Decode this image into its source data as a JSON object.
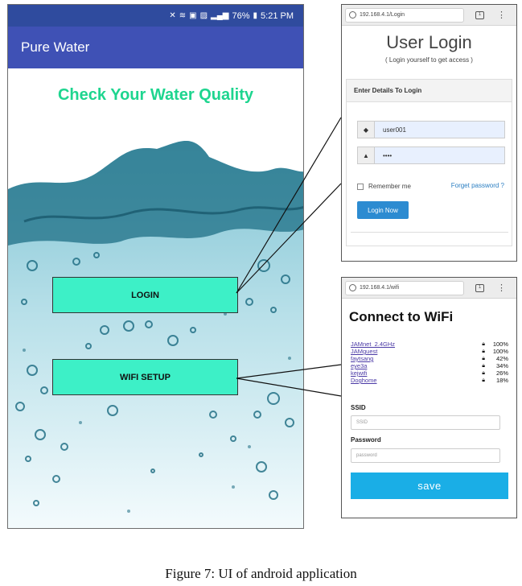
{
  "phone": {
    "status": {
      "battery": "76%",
      "time": "5:21 PM"
    },
    "app_title": "Pure Water",
    "headline": "Check Your Water Quality",
    "login_button": "LOGIN",
    "wifi_button": "WIFI SETUP",
    "colors": {
      "appbar": "#3f51b5",
      "headline": "#1ed58f",
      "button": "#3df0c7"
    }
  },
  "login_panel": {
    "url": "192.168.4.1/Login",
    "title": "User Login",
    "subtitle": "( Login yourself to get access )",
    "card_header": "Enter Details To Login",
    "username_value": "user001",
    "password_value": "••••",
    "remember_label": "Remember me",
    "forgot_link": "Forget password ?",
    "submit_label": "Login Now"
  },
  "wifi_panel": {
    "url": "192.168.4.1/wifi",
    "title": "Connect to WiFi",
    "networks": [
      {
        "name": "JAMnet_2.4GHz",
        "signal": "100%"
      },
      {
        "name": "JAMguest",
        "signal": "100%"
      },
      {
        "name": "faytsang",
        "signal": "42%"
      },
      {
        "name": "eye3a",
        "signal": "34%"
      },
      {
        "name": "kejwifi",
        "signal": "26%"
      },
      {
        "name": "Doghome",
        "signal": "18%"
      }
    ],
    "ssid_label": "SSID",
    "ssid_placeholder": "SSID",
    "password_label": "Password",
    "password_placeholder": "password",
    "save_label": "save"
  },
  "caption": "Figure 7: UI of android application"
}
